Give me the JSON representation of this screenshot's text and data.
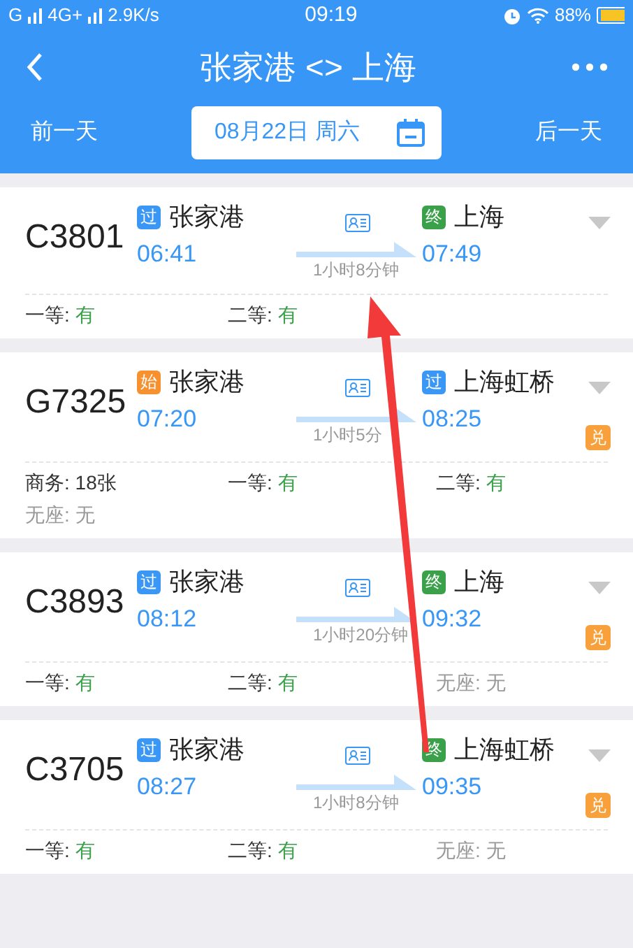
{
  "status_bar": {
    "carrier": "G",
    "network": "4G+",
    "speed": "2.9K/s",
    "time": "09:19",
    "battery": "88%"
  },
  "header": {
    "title": "张家港 <> 上海"
  },
  "date_bar": {
    "previous": "前一天",
    "date": "08月22日 周六",
    "next": "后一天"
  },
  "trains": [
    {
      "number": "C3801",
      "from_badge": {
        "text": "过",
        "color": "#3b97f5"
      },
      "from": "张家港",
      "depart": "06:41",
      "duration": "1小时8分钟",
      "to_badge": {
        "text": "终",
        "color": "#3aa14a"
      },
      "to": "上海",
      "arrive": "07:49",
      "seats": [
        {
          "label": "一等:",
          "value": "有",
          "kind": "yes"
        },
        {
          "label": "二等:",
          "value": "有",
          "kind": "yes"
        }
      ]
    },
    {
      "number": "G7325",
      "from_badge": {
        "text": "始",
        "color": "#f7902e"
      },
      "from": "张家港",
      "depart": "07:20",
      "duration": "1小时5分",
      "to_badge": {
        "text": "过",
        "color": "#3b97f5"
      },
      "to": "上海虹桥",
      "arrive": "08:25",
      "exchange": "兑",
      "seats": [
        {
          "label": "商务:",
          "value": "18张",
          "kind": "count"
        },
        {
          "label": "一等:",
          "value": "有",
          "kind": "yes"
        },
        {
          "label": "二等:",
          "value": "有",
          "kind": "yes"
        },
        {
          "label": "无座:",
          "value": "无",
          "kind": "none"
        }
      ]
    },
    {
      "number": "C3893",
      "from_badge": {
        "text": "过",
        "color": "#3b97f5"
      },
      "from": "张家港",
      "depart": "08:12",
      "duration": "1小时20分钟",
      "to_badge": {
        "text": "终",
        "color": "#3aa14a"
      },
      "to": "上海",
      "arrive": "09:32",
      "exchange": "兑",
      "seats": [
        {
          "label": "一等:",
          "value": "有",
          "kind": "yes"
        },
        {
          "label": "二等:",
          "value": "有",
          "kind": "yes"
        },
        {
          "label": "无座:",
          "value": "无",
          "kind": "none"
        }
      ]
    },
    {
      "number": "C3705",
      "from_badge": {
        "text": "过",
        "color": "#3b97f5"
      },
      "from": "张家港",
      "depart": "08:27",
      "duration": "1小时8分钟",
      "to_badge": {
        "text": "终",
        "color": "#3aa14a"
      },
      "to": "上海虹桥",
      "arrive": "09:35",
      "exchange": "兑",
      "seats": [
        {
          "label": "一等:",
          "value": "有",
          "kind": "yes"
        },
        {
          "label": "二等:",
          "value": "有",
          "kind": "yes"
        },
        {
          "label": "无座:",
          "value": "无",
          "kind": "none"
        }
      ]
    }
  ]
}
